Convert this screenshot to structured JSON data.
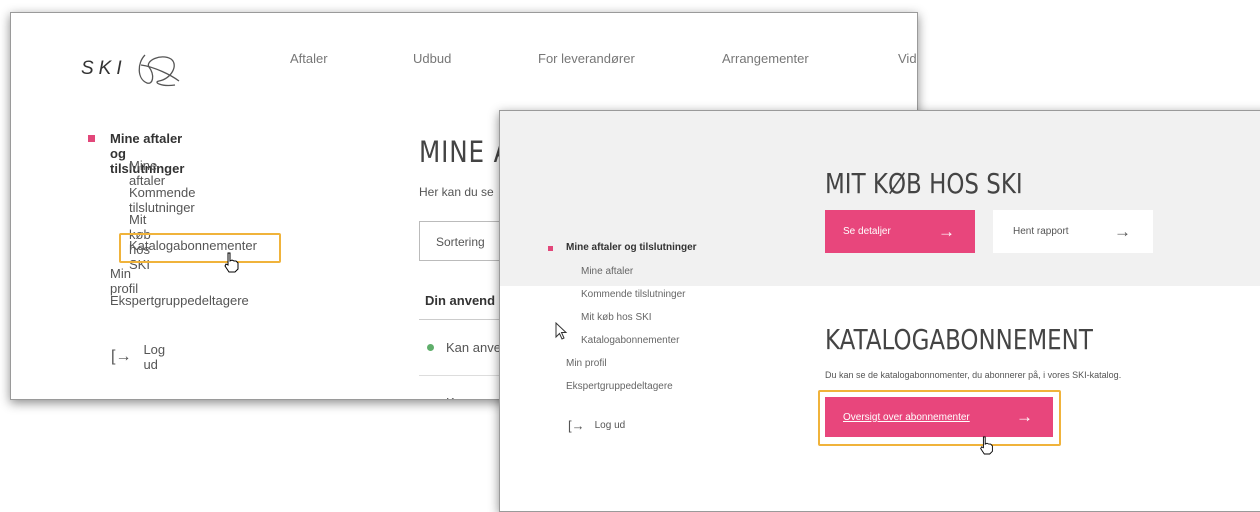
{
  "win1": {
    "logo_text": "SKI",
    "nav": [
      "Aftaler",
      "Udbud",
      "For leverandører",
      "Arrangementer",
      "Vid"
    ],
    "sidebar": {
      "parent": "Mine aftaler og tilslutninger",
      "sub": [
        "Mine aftaler",
        "Kommende tilslutninger",
        "Mit køb hos SKI",
        "Katalogabonnementer"
      ],
      "top": [
        "Min profil",
        "Ekspertgruppedeltagere"
      ],
      "logout": "Log ud"
    },
    "main": {
      "title": "MINE A",
      "intro": "Her kan du se",
      "sort_label": "Sortering",
      "tab": "Din anvend",
      "row1": "Kan anve",
      "row2": "K"
    }
  },
  "win2": {
    "section1": {
      "title": "MIT KØB HOS SKI",
      "btn_details": "Se detaljer",
      "btn_report": "Hent rapport"
    },
    "section2": {
      "title": "KATALOGABONNEMENT",
      "intro": "Du kan se de katalogabonnomenter, du abonnerer på, i vores SKI-katalog.",
      "btn_overview": "Oversigt over abonnementer"
    },
    "sidebar": {
      "parent": "Mine aftaler og tilslutninger",
      "sub": [
        "Mine aftaler",
        "Kommende tilslutninger",
        "Mit køb hos SKI",
        "Katalogabonnementer"
      ],
      "top": [
        "Min profil",
        "Ekspertgruppedeltagere"
      ],
      "logout": "Log ud"
    }
  },
  "colors": {
    "accent": "#e8467c",
    "highlight": "#f0b33b",
    "status_green": "#5fae6b"
  },
  "icons": {
    "arrow": "→",
    "logout": "[→"
  }
}
